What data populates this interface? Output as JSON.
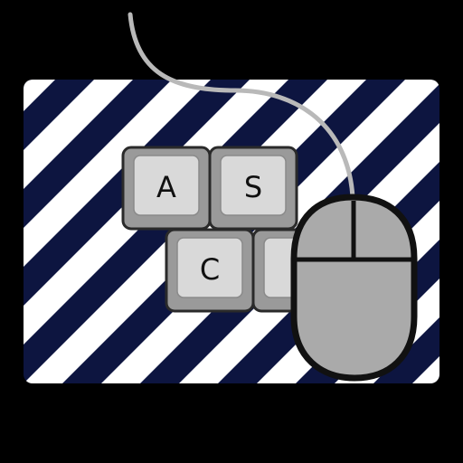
{
  "colors": {
    "background": "#000000",
    "stripe_dark": "#0d1540",
    "stripe_light": "#ffffff",
    "key_outer": "#9a9a9a",
    "key_inner": "#d9d9d9",
    "key_outline": "#2a2a2a",
    "mouse_body": "#aaaaaa",
    "mouse_outline": "#111111",
    "cable": "#b9b9b9"
  },
  "icons": {
    "mousepad": "striped-mousepad",
    "keyboard": "keyboard-keys",
    "mouse": "computer-mouse"
  },
  "keys": [
    {
      "label": "A"
    },
    {
      "label": "S"
    },
    {
      "label": "C"
    },
    {
      "label": ""
    }
  ]
}
